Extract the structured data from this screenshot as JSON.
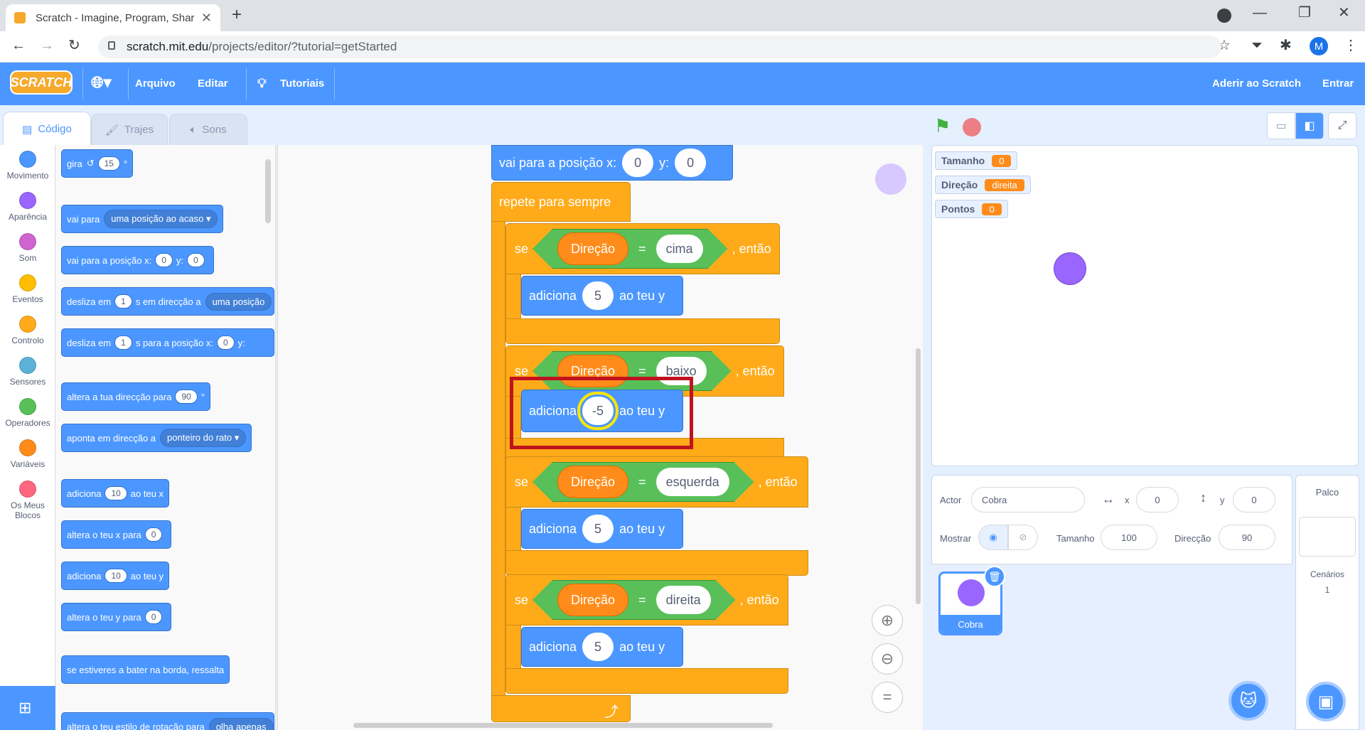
{
  "browser": {
    "tab_title": "Scratch - Imagine, Program, Shar",
    "url_host": "scratch.mit.edu",
    "url_path": "/projects/editor/?tutorial=getStarted",
    "profile_initial": "M"
  },
  "menu": {
    "logo": "SCRATCH",
    "file": "Arquivo",
    "edit": "Editar",
    "tutorials": "Tutoriais",
    "join": "Aderir ao Scratch",
    "signin": "Entrar"
  },
  "tabs": {
    "code": "Código",
    "costumes": "Trajes",
    "sounds": "Sons"
  },
  "categories": [
    {
      "label": "Movimento",
      "color": "#4c97ff"
    },
    {
      "label": "Aparência",
      "color": "#9966ff"
    },
    {
      "label": "Som",
      "color": "#cf63cf"
    },
    {
      "label": "Eventos",
      "color": "#ffbf00"
    },
    {
      "label": "Controlo",
      "color": "#ffab19"
    },
    {
      "label": "Sensores",
      "color": "#5cb1d6"
    },
    {
      "label": "Operadores",
      "color": "#59c059"
    },
    {
      "label": "Variáveis",
      "color": "#ff8c1a"
    },
    {
      "label": "Os Meus Blocos",
      "color": "#ff6680"
    }
  ],
  "palette": {
    "turn": {
      "a": "gira",
      "v": "15",
      "b": "°"
    },
    "goto": {
      "a": "vai para",
      "dd": "uma posição ao acaso"
    },
    "gotoxy": {
      "a": "vai para a posição x:",
      "x": "0",
      "b": "y:",
      "y": "0"
    },
    "glide": {
      "a": "desliza em",
      "v": "1",
      "b": "s em direcção a",
      "dd": "uma posição"
    },
    "glidexy": {
      "a": "desliza em",
      "v": "1",
      "b": "s para a posição x:",
      "x": "0",
      "c": "y:"
    },
    "pointdir": {
      "a": "altera a tua direcção para",
      "v": "90",
      "b": "°"
    },
    "pointto": {
      "a": "aponta em direcção a",
      "dd": "ponteiro do rato"
    },
    "changex": {
      "a": "adiciona",
      "v": "10",
      "b": "ao teu x"
    },
    "setx": {
      "a": "altera o teu x para",
      "v": "0"
    },
    "changey": {
      "a": "adiciona",
      "v": "10",
      "b": "ao teu y"
    },
    "sety": {
      "a": "altera o teu y para",
      "v": "0"
    },
    "bounce": {
      "a": "se estiveres a bater na borda, ressalta"
    },
    "rotstyle": {
      "a": "altera o teu estilo de rotação para",
      "dd": "olha apenas"
    }
  },
  "script": {
    "gotoxy": {
      "a": "vai para a posição x:",
      "x": "0",
      "b": "y:",
      "y": "0"
    },
    "forever": "repete para sempre",
    "if_word": "se",
    "then_word": ", então",
    "var": "Direção",
    "eq": "=",
    "change_word": "adiciona",
    "suffix": "ao teu y",
    "ifs": [
      {
        "value": "cima",
        "delta": "5"
      },
      {
        "value": "baixo",
        "delta": "-5"
      },
      {
        "value": "esquerda",
        "delta": "5"
      },
      {
        "value": "direita",
        "delta": "5"
      }
    ]
  },
  "monitors": [
    {
      "name": "Tamanho",
      "value": "0"
    },
    {
      "name": "Direção",
      "value": "direita"
    },
    {
      "name": "Pontos",
      "value": "0"
    }
  ],
  "sprite": {
    "actor_label": "Actor",
    "name": "Cobra",
    "x_label": "x",
    "x": "0",
    "y_label": "y",
    "y": "0",
    "show_label": "Mostrar",
    "size_label": "Tamanho",
    "size": "100",
    "dir_label": "Direcção",
    "direction": "90",
    "thumb_name": "Cobra"
  },
  "stage_panel": {
    "title": "Palco",
    "backdrops_label": "Cenários",
    "backdrops_count": "1"
  },
  "colors": {
    "motion": "#4c97ff",
    "control": "#ffab19",
    "operator": "#59c059",
    "variable": "#ff8c1a",
    "highlight_red": "#c1121f",
    "highlight_yellow": "#ffe600"
  }
}
